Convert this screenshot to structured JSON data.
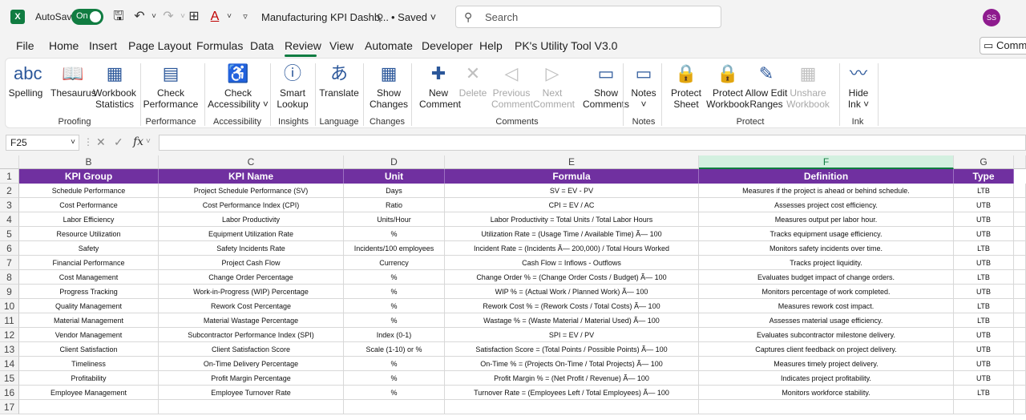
{
  "titlebar": {
    "logo": "X",
    "autosave_label": "AutoSave",
    "toggle_label": "On",
    "doc_title": "Manufacturing KPI Dashb...",
    "saved": "• Saved",
    "search_placeholder": "Search",
    "avatar": "SS"
  },
  "tabs": [
    "File",
    "Home",
    "Insert",
    "Page Layout",
    "Formulas",
    "Data",
    "Review",
    "View",
    "Automate",
    "Developer",
    "Help",
    "PK's Utility Tool V3.0"
  ],
  "active_tab": "Review",
  "comments_button": "Comme",
  "ribbon": {
    "buttons": [
      {
        "label1": "Spelling",
        "label2": "",
        "icon": "spelling-icon",
        "glyph": "abc"
      },
      {
        "label1": "Thesaurus",
        "label2": "",
        "icon": "thesaurus-icon",
        "glyph": "📖"
      },
      {
        "label1": "Workbook",
        "label2": "Statistics",
        "icon": "workbook-statistics-icon",
        "glyph": "▦"
      },
      {
        "label1": "Check",
        "label2": "Performance",
        "icon": "check-performance-icon",
        "glyph": "▤"
      },
      {
        "label1": "Check",
        "label2": "Accessibility ˅",
        "icon": "check-accessibility-icon",
        "glyph": "♿"
      },
      {
        "label1": "Smart",
        "label2": "Lookup",
        "icon": "smart-lookup-icon",
        "glyph": "ⓘ"
      },
      {
        "label1": "Translate",
        "label2": "",
        "icon": "translate-icon",
        "glyph": "あ"
      },
      {
        "label1": "Show",
        "label2": "Changes",
        "icon": "show-changes-icon",
        "glyph": "▦"
      },
      {
        "label1": "New",
        "label2": "Comment",
        "icon": "new-comment-icon",
        "glyph": "✚"
      },
      {
        "label1": "Delete",
        "label2": "",
        "icon": "delete-comment-icon",
        "glyph": "✕"
      },
      {
        "label1": "Previous",
        "label2": "Comment",
        "icon": "previous-comment-icon",
        "glyph": "◁"
      },
      {
        "label1": "Next",
        "label2": "Comment",
        "icon": "next-comment-icon",
        "glyph": "▷"
      },
      {
        "label1": "Show",
        "label2": "Comments",
        "icon": "show-comments-icon",
        "glyph": "▭"
      },
      {
        "label1": "Notes",
        "label2": "˅",
        "icon": "notes-icon",
        "glyph": "▭"
      },
      {
        "label1": "Protect",
        "label2": "Sheet",
        "icon": "protect-sheet-icon",
        "glyph": "🔒"
      },
      {
        "label1": "Protect",
        "label2": "Workbook",
        "icon": "protect-workbook-icon",
        "glyph": "🔒"
      },
      {
        "label1": "Allow Edit",
        "label2": "Ranges",
        "icon": "allow-edit-ranges-icon",
        "glyph": "✎"
      },
      {
        "label1": "Unshare",
        "label2": "Workbook",
        "icon": "unshare-workbook-icon",
        "glyph": "▦"
      },
      {
        "label1": "Hide",
        "label2": "Ink ˅",
        "icon": "hide-ink-icon",
        "glyph": "〰"
      }
    ],
    "groups": [
      "Proofing",
      "Performance",
      "Accessibility",
      "Insights",
      "Language",
      "Changes",
      "Comments",
      "Notes",
      "Protect",
      "Ink"
    ]
  },
  "formula_bar": {
    "name_box": "F25",
    "fx": "fx"
  },
  "sheet": {
    "columns": [
      "B",
      "C",
      "D",
      "E",
      "F",
      "G"
    ],
    "selected_column": "F",
    "row_numbers": [
      "1",
      "2",
      "3",
      "4",
      "5",
      "6",
      "7",
      "8",
      "9",
      "10",
      "11",
      "12",
      "13",
      "14",
      "15",
      "16",
      "17"
    ],
    "headers": [
      "KPI Group",
      "KPI Name",
      "Unit",
      "Formula",
      "Definition",
      "Type"
    ],
    "header_color": "#7030a0",
    "rows": [
      [
        "Schedule Performance",
        "Project Schedule Performance (SV)",
        "Days",
        "SV = EV - PV",
        "Measures if the project is ahead or behind schedule.",
        "LTB"
      ],
      [
        "Cost Performance",
        "Cost Performance Index (CPI)",
        "Ratio",
        "CPI = EV / AC",
        "Assesses project cost efficiency.",
        "UTB"
      ],
      [
        "Labor Efficiency",
        "Labor Productivity",
        "Units/Hour",
        "Labor Productivity = Total Units / Total Labor Hours",
        "Measures output per labor hour.",
        "UTB"
      ],
      [
        "Resource Utilization",
        "Equipment Utilization Rate",
        "%",
        "Utilization Rate = (Usage Time / Available Time) Ã— 100",
        "Tracks equipment usage efficiency.",
        "UTB"
      ],
      [
        "Safety",
        "Safety Incidents Rate",
        "Incidents/100 employees",
        "Incident Rate = (Incidents Ã— 200,000) / Total Hours Worked",
        "Monitors safety incidents over time.",
        "LTB"
      ],
      [
        "Financial Performance",
        "Project Cash Flow",
        "Currency",
        "Cash Flow = Inflows - Outflows",
        "Tracks project liquidity.",
        "UTB"
      ],
      [
        "Cost Management",
        "Change Order Percentage",
        "%",
        "Change Order % = (Change Order Costs / Budget) Ã— 100",
        "Evaluates budget impact of change orders.",
        "LTB"
      ],
      [
        "Progress Tracking",
        "Work-in-Progress (WIP) Percentage",
        "%",
        "WIP % = (Actual Work / Planned Work) Ã— 100",
        "Monitors percentage of work completed.",
        "UTB"
      ],
      [
        "Quality Management",
        "Rework Cost Percentage",
        "%",
        "Rework Cost % = (Rework Costs / Total Costs) Ã— 100",
        "Measures rework cost impact.",
        "LTB"
      ],
      [
        "Material Management",
        "Material Wastage Percentage",
        "%",
        "Wastage % = (Waste Material / Material Used) Ã— 100",
        "Assesses material usage efficiency.",
        "LTB"
      ],
      [
        "Vendor Management",
        "Subcontractor Performance Index (SPI)",
        "Index (0-1)",
        "SPI = EV / PV",
        "Evaluates subcontractor milestone delivery.",
        "UTB"
      ],
      [
        "Client Satisfaction",
        "Client Satisfaction Score",
        "Scale (1-10) or %",
        "Satisfaction Score = (Total Points / Possible Points) Ã— 100",
        "Captures client feedback on project delivery.",
        "UTB"
      ],
      [
        "Timeliness",
        "On-Time Delivery Percentage",
        "%",
        "On-Time % = (Projects On-Time / Total Projects) Ã— 100",
        "Measures timely project delivery.",
        "UTB"
      ],
      [
        "Profitability",
        "Profit Margin Percentage",
        "%",
        "Profit Margin % = (Net Profit / Revenue) Ã— 100",
        "Indicates project profitability.",
        "UTB"
      ],
      [
        "Employee Management",
        "Employee Turnover Rate",
        "%",
        "Turnover Rate = (Employees Left / Total Employees) Ã— 100",
        "Monitors workforce stability.",
        "LTB"
      ]
    ]
  }
}
